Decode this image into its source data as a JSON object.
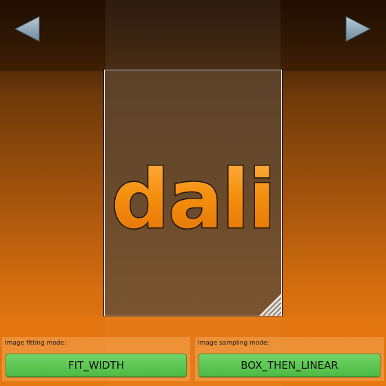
{
  "navigation": {
    "prev_icon": "triangle-left-icon",
    "next_icon": "triangle-right-icon"
  },
  "image_card": {
    "logo_text": "dali",
    "logo_color": "#f28a0f",
    "corner_icon": "stripe-corner-icon"
  },
  "controls": {
    "fitting": {
      "label": "Image fitting mode:",
      "value": "FIT_WIDTH"
    },
    "sampling": {
      "label": "Image sampling mode:",
      "value": "BOX_THEN_LINEAR"
    }
  },
  "colors": {
    "button_green": "#5cc752",
    "background_orange": "#e57a12"
  }
}
